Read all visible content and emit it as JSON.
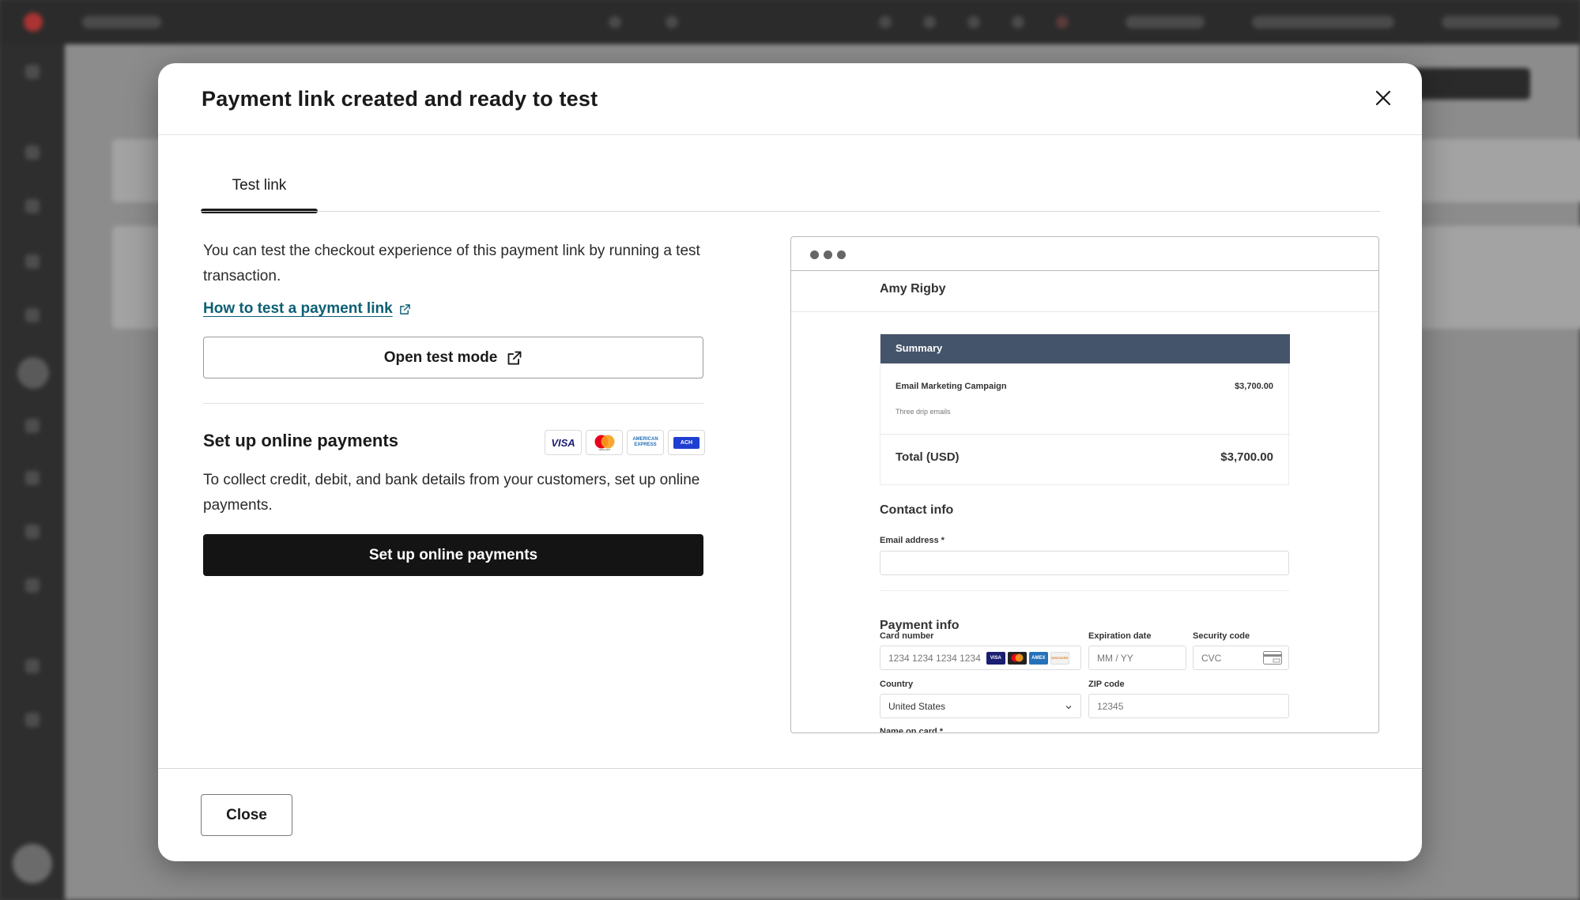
{
  "modal": {
    "title": "Payment link created and ready to test"
  },
  "tabs": [
    {
      "label": "Test link"
    }
  ],
  "test": {
    "intro": "You can test the checkout experience of this payment link by running a test transaction.",
    "help_link": "How to test a payment link",
    "open_button": "Open test mode"
  },
  "setup": {
    "title": "Set up online payments",
    "card_logos": [
      "VISA",
      "mastercard",
      "AMERICAN EXPRESS",
      "ACH"
    ],
    "description": "To collect credit, debit, and bank details from your customers, set up online payments.",
    "button": "Set up online payments"
  },
  "preview": {
    "merchant": "Amy Rigby",
    "summary_title": "Summary",
    "item_name": "Email Marketing Campaign",
    "item_price": "$3,700.00",
    "item_desc": "Three drip emails",
    "total_label": "Total (USD)",
    "total_value": "$3,700.00",
    "contact_title": "Contact info",
    "email_label": "Email address *",
    "payment_title": "Payment info",
    "card_number_label": "Card number",
    "card_number_placeholder": "1234 1234 1234 1234",
    "mini_cards": [
      "VISA",
      "MC",
      "AMEX",
      "DISCOVER"
    ],
    "expiry_label": "Expiration date",
    "expiry_placeholder": "MM / YY",
    "security_label": "Security code",
    "security_placeholder": "CVC",
    "country_label": "Country",
    "country_value": "United States",
    "zip_label": "ZIP code",
    "zip_placeholder": "12345",
    "name_label": "Name on card *"
  },
  "footer": {
    "close_button": "Close"
  },
  "colors": {
    "link": "#0b5f74",
    "summary_header": "#44546a",
    "primary_button": "#141414"
  }
}
